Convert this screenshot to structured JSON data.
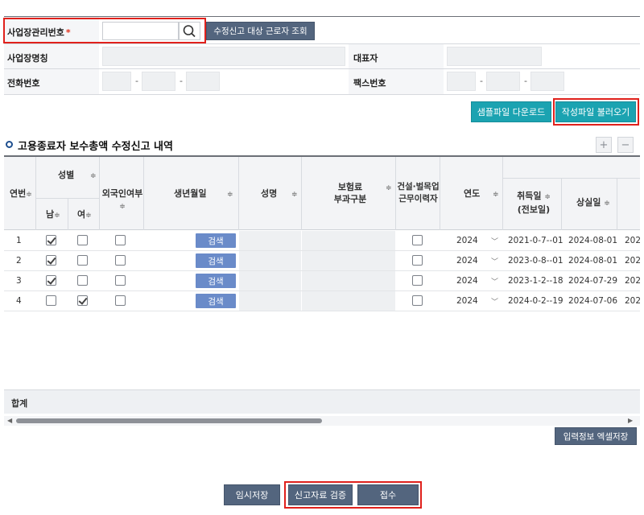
{
  "form": {
    "biz_no_label": "사업장관리번호",
    "required_mark": "*",
    "biz_no_value": "",
    "lookup_button": "수정신고 대상 근로자 조회",
    "biz_name_label": "사업장명칭",
    "rep_label": "대표자",
    "phone_label": "전화번호",
    "fax_label": "팩스번호",
    "sep": "-"
  },
  "actions": {
    "sample_download": "샘플파일 다운로드",
    "load_file": "작성파일 불러오기"
  },
  "section": {
    "title": "고용종료자 보수총액 수정신고 내역",
    "add": "+",
    "remove": "−"
  },
  "grid": {
    "headers": {
      "row_no": "연번",
      "gender": "성별",
      "male": "남",
      "female": "여",
      "foreigner": "외국인여부",
      "birth": "생년월일",
      "name": "성명",
      "insurance_1": "보험료",
      "insurance_2": "부과구분",
      "construction_1": "건설·벌목업",
      "construction_2": "근무이력자",
      "year": "연도",
      "acquire_1": "취득일",
      "acquire_2": "(전보일)",
      "loss": "상실일"
    },
    "sort_glyph": "≑",
    "search_label": "검색",
    "rows": [
      {
        "no": "1",
        "male": true,
        "female": false,
        "foreigner": false,
        "construction": false,
        "year": "2024",
        "acquire": "2021-0-7--01",
        "loss": "2024-08-01",
        "next": "202"
      },
      {
        "no": "2",
        "male": true,
        "female": false,
        "foreigner": false,
        "construction": false,
        "year": "2024",
        "acquire": "2023-0-8--01",
        "loss": "2024-08-01",
        "next": "202"
      },
      {
        "no": "3",
        "male": true,
        "female": false,
        "foreigner": false,
        "construction": false,
        "year": "2024",
        "acquire": "2023-1-2--18",
        "loss": "2024-07-29",
        "next": "202"
      },
      {
        "no": "4",
        "male": false,
        "female": true,
        "foreigner": false,
        "construction": false,
        "year": "2024",
        "acquire": "2024-0-2--19",
        "loss": "2024-07-06",
        "next": "202"
      }
    ]
  },
  "total": {
    "label": "합계"
  },
  "excel_save": "입력정보 엑셀저장",
  "bottom": {
    "temp_save": "임시저장",
    "verify": "신고자료 검증",
    "submit": "접수"
  },
  "colors": {
    "accent_red": "#e0211c",
    "teal": "#1ba3b1",
    "dark_button": "#53657e",
    "search_button": "#6a8bc9"
  }
}
